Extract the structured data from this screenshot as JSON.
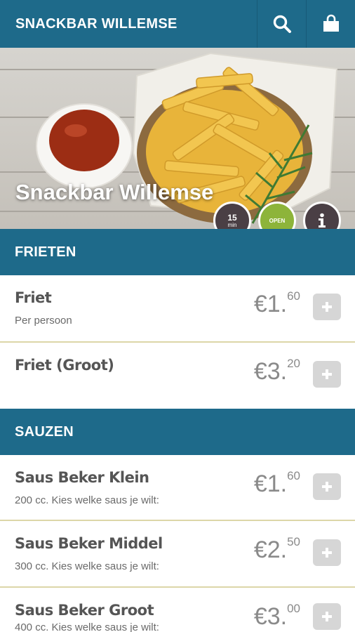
{
  "header": {
    "title": "SNACKBAR WILLEMSE",
    "search_icon": "search-icon",
    "bag_icon": "shopping-bag-icon",
    "color": "#1e6a8a"
  },
  "hero": {
    "title": "Snackbar Willemse",
    "badges": {
      "delivery_time_value": "15",
      "delivery_time_unit": "min",
      "status": "OPEN",
      "info_icon": "info-icon"
    }
  },
  "sections": [
    {
      "title": "FRIETEN",
      "items": [
        {
          "name": "Friet",
          "description": "Per persoon",
          "price_whole": "€1.",
          "price_cents": "60"
        },
        {
          "name": "Friet (Groot)",
          "description": "",
          "price_whole": "€3.",
          "price_cents": "20"
        }
      ]
    },
    {
      "title": "SAUZEN",
      "items": [
        {
          "name": "Saus Beker Klein",
          "description": "200 cc. Kies welke saus je wilt:",
          "price_whole": "€1.",
          "price_cents": "60"
        },
        {
          "name": "Saus Beker Middel",
          "description": "300 cc. Kies welke saus je wilt:",
          "price_whole": "€2.",
          "price_cents": "50"
        },
        {
          "name": "Saus Beker Groot",
          "description": "400 cc. Kies welke saus je wilt:",
          "price_whole": "€3.",
          "price_cents": "00"
        }
      ]
    }
  ],
  "colors": {
    "primary": "#1e6a8a",
    "open": "#8db43a",
    "badge_dark": "#4a3f45",
    "divider": "#dcd6a8"
  }
}
